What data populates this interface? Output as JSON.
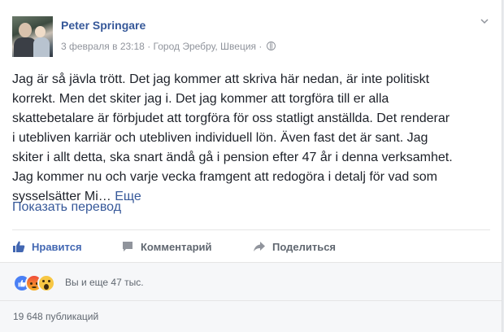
{
  "post": {
    "author": "Peter Springare",
    "date": "3 февраля в 23:18",
    "separator": " · ",
    "location": "Город Эребру, Швеция",
    "privacy_separator": " · ",
    "privacy_icon": "globe-icon",
    "text": "Jag är så jävla trött. Det jag kommer att skriva här nedan, är inte politiskt\nkorrekt. Men det skiter jag i. Det jag kommer att torgföra till er alla\nskattebetalare är förbjudet att torgföra för oss statligt anställda. Det renderar\ni utebliven karriär och utebliven individuell lön. Även fast det är sant. Jag\nskiter i allt detta, ska snart ändå gå i pension efter 47 år i denna verksamhet.\nJag kommer nu och varje vecka framgent att redogöra i detalj för vad som\nsysselsätter Mi…",
    "see_more": "Еще",
    "translate": "Показать перевод"
  },
  "actions": {
    "like": "Нравится",
    "comment": "Комментарий",
    "share": "Поделиться"
  },
  "reactions": {
    "types": [
      "like",
      "angry",
      "wow"
    ],
    "summary": "Вы и еще 47 тыс."
  },
  "shares": {
    "count_text": "19 648 публикаций"
  },
  "colors": {
    "link": "#365899",
    "like_active": "#4267b2",
    "muted": "#90949c",
    "action_gray": "#606770",
    "footer_bg": "#f6f7f9"
  }
}
